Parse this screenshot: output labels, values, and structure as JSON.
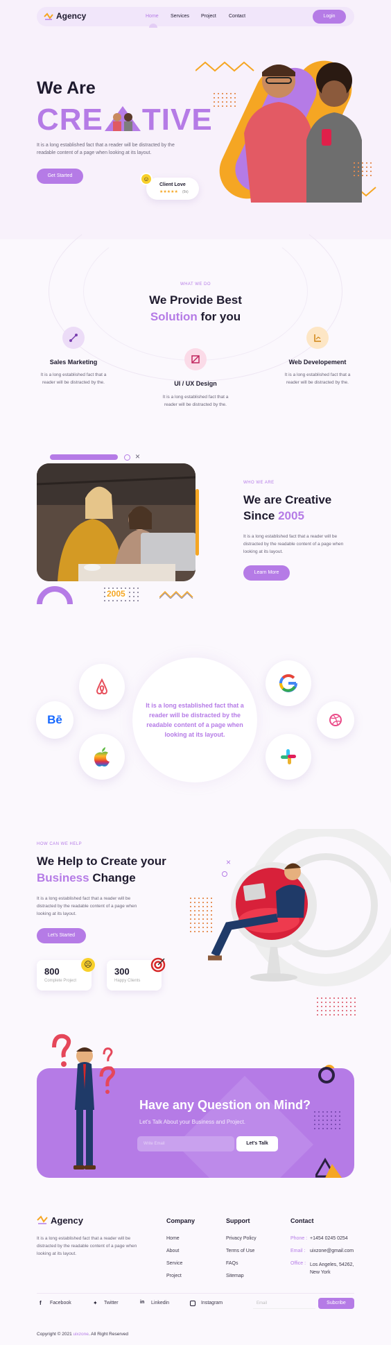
{
  "nav": {
    "brand": "Agency",
    "links": [
      "Home",
      "Services",
      "Project",
      "Contact"
    ],
    "login": "Login"
  },
  "hero": {
    "line1": "We Are",
    "line2a": "CRE",
    "line2b": "TIVE",
    "desc": "It is a long established fact that a reader will be distracted by the readable content of a page when looking at its layout.",
    "cta": "Get Started",
    "client_love": "Client Love",
    "rating_text": "(5k)",
    "stars": 5
  },
  "services": {
    "kicker": "WHAT WE DO",
    "title1": "We Provide Best",
    "title2a": "Solution",
    "title2b": " for you",
    "items": [
      {
        "title": "Sales Marketing",
        "desc": "It is a long established fact that a reader will be distracted by the."
      },
      {
        "title": "UI / UX Design",
        "desc": "It is a long established fact that a reader will be distracted by the."
      },
      {
        "title": "Web Developement",
        "desc": "It is a long established fact that a reader will be distracted by the."
      }
    ]
  },
  "about": {
    "kicker": "WHO WE ARE",
    "title1": "We are Creative",
    "title2a": "Since ",
    "title2b": "2005",
    "desc": "It is a long established fact that a reader will be distracted by the readable content of a page when looking at its layout.",
    "cta": "Learn More",
    "year_badge": "2005"
  },
  "partners": {
    "center_text": "It is a long established fact that a reader will be distracted by the readable content of a page when looking at its layout."
  },
  "help": {
    "kicker": "HOW CAN WE HELP",
    "title1": "We Help to Create your",
    "title2a": "Business",
    "title2b": " Change",
    "desc": "It is a long established fact that a reader will be distracted by the readable content of a page when looking at its layout.",
    "cta": "Let's Started",
    "stats": [
      {
        "value": "800",
        "label": "Complete Project"
      },
      {
        "value": "300",
        "label": "Happy Clients"
      }
    ]
  },
  "question": {
    "title": "Have any Question on Mind?",
    "subtitle": "Let's Talk About your Business and Project.",
    "placeholder": "Write Email",
    "cta": "Let's Talk"
  },
  "footer": {
    "brand": "Agency",
    "desc": "It is a long established fact that a reader will be distracted by the readable content of a page when looking at its layout.",
    "company_head": "Company",
    "company": [
      "Home",
      "About",
      "Service",
      "Project"
    ],
    "support_head": "Support",
    "support": [
      "Privacy Policy",
      "Terms of Use",
      "FAQs",
      "Sitemap"
    ],
    "contact_head": "Contact",
    "phone_label": "Phone :",
    "phone": "+1454 0245 0254",
    "email_label": "Email :",
    "email": "uixzone@gmail.com",
    "office_label": "Office :",
    "office": "Los Angeles, 54262, New York",
    "social": [
      "Facebook",
      "Twitter",
      "Linkedin",
      "Instagram"
    ],
    "sub_placeholder": "Email",
    "subscribe": "Subcribe",
    "copyright_a": "Copyright © 2021 ",
    "copyright_b": "uixzone",
    "copyright_c": ". All Right Reserved"
  },
  "colors": {
    "accent": "#b57be6",
    "orange": "#f5a623",
    "dark": "#1e1a2e"
  }
}
